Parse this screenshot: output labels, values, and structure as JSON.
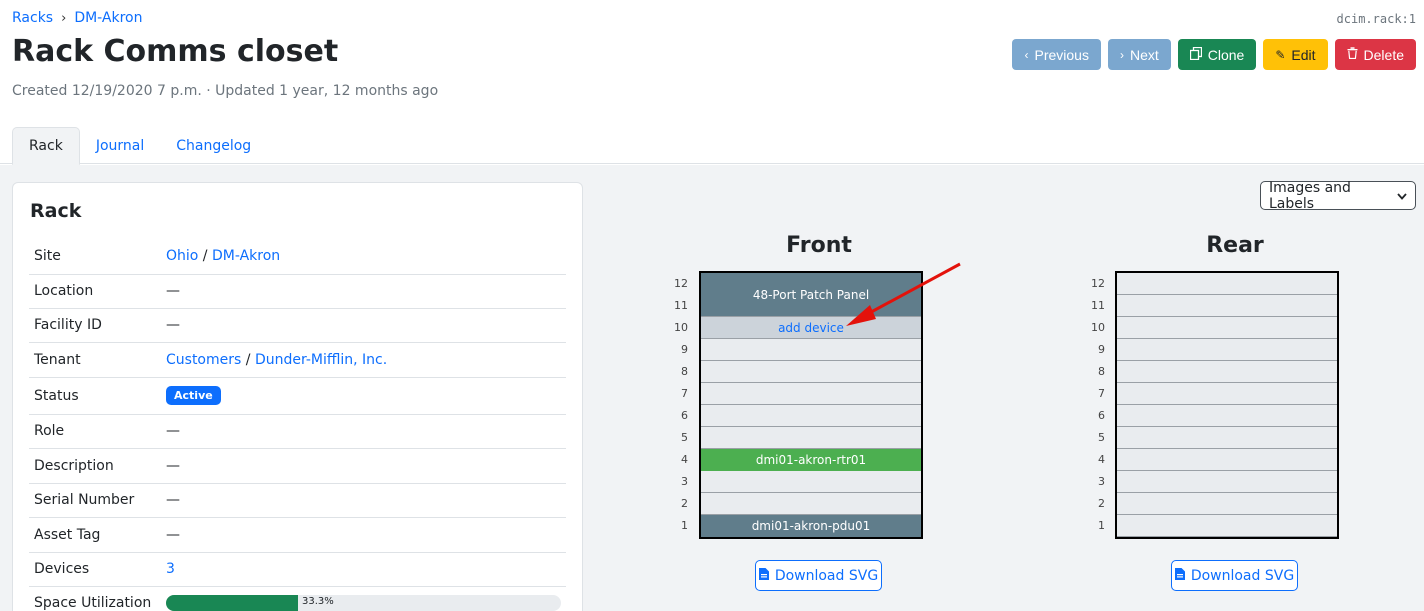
{
  "breadcrumb": {
    "parent": "Racks",
    "current": "DM-Akron"
  },
  "object_id": "dcim.rack:1",
  "title": "Rack Comms closet",
  "meta": "Created 12/19/2020 7 p.m. · Updated 1 year, 12 months ago",
  "actions": {
    "previous": "Previous",
    "next": "Next",
    "clone": "Clone",
    "edit": "Edit",
    "delete": "Delete"
  },
  "tabs": [
    {
      "label": "Rack",
      "active": true
    },
    {
      "label": "Journal"
    },
    {
      "label": "Changelog"
    }
  ],
  "card": {
    "title": "Rack",
    "rows": {
      "site": {
        "label": "Site",
        "part1": "Ohio",
        "sep": " / ",
        "part2": "DM-Akron"
      },
      "location": {
        "label": "Location",
        "value": "—"
      },
      "facility_id": {
        "label": "Facility ID",
        "value": "—"
      },
      "tenant": {
        "label": "Tenant",
        "part1": "Customers",
        "sep": " / ",
        "part2": "Dunder-Mifflin, Inc."
      },
      "status": {
        "label": "Status",
        "value": "Active"
      },
      "role": {
        "label": "Role",
        "value": "—"
      },
      "description": {
        "label": "Description",
        "value": "—"
      },
      "serial": {
        "label": "Serial Number",
        "value": "—"
      },
      "asset_tag": {
        "label": "Asset Tag",
        "value": "—"
      },
      "devices": {
        "label": "Devices",
        "value": "3"
      },
      "space": {
        "label": "Space Utilization",
        "value": "33.3%",
        "fraction": 0.333
      }
    }
  },
  "view_select": {
    "selected": "Images and Labels"
  },
  "front": {
    "heading": "Front",
    "units": [
      "12",
      "11",
      "10",
      "9",
      "8",
      "7",
      "6",
      "5",
      "4",
      "3",
      "2",
      "1"
    ],
    "devices": {
      "panel": "48-Port Patch Panel",
      "rtr": "dmi01-akron-rtr01",
      "pdu": "dmi01-akron-pdu01"
    },
    "add_device": "add device",
    "download": "Download SVG"
  },
  "rear": {
    "heading": "Rear",
    "units": [
      "12",
      "11",
      "10",
      "9",
      "8",
      "7",
      "6",
      "5",
      "4",
      "3",
      "2",
      "1"
    ],
    "download": "Download SVG"
  },
  "colors": {
    "primary": "#0d6efd",
    "success": "#198754",
    "warning": "#ffc107",
    "danger": "#dc3545",
    "device_gray": "#607d8b",
    "device_green": "#4caf50",
    "annotation_arrow": "#e3120b"
  }
}
